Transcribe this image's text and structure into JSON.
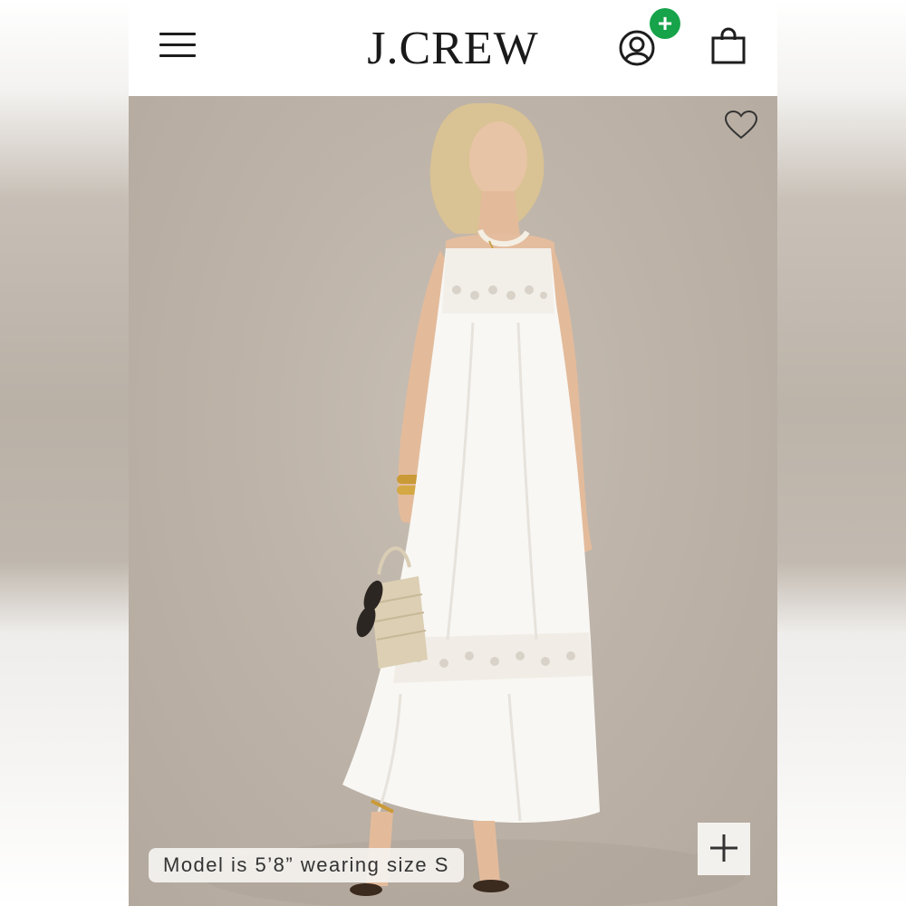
{
  "header": {
    "brand": "J.CREW",
    "menu_icon": "hamburger-menu-icon",
    "account_icon": "account-icon",
    "account_badge": "+",
    "bag_icon": "shopping-bag-icon"
  },
  "product": {
    "favorite_icon": "heart-icon",
    "model_caption": "Model is 5’8” wearing size S",
    "zoom_icon": "plus-icon"
  },
  "colors": {
    "badge": "#16a34a",
    "backdrop": "#bdb3a8",
    "dress": "#f8f7f4"
  }
}
